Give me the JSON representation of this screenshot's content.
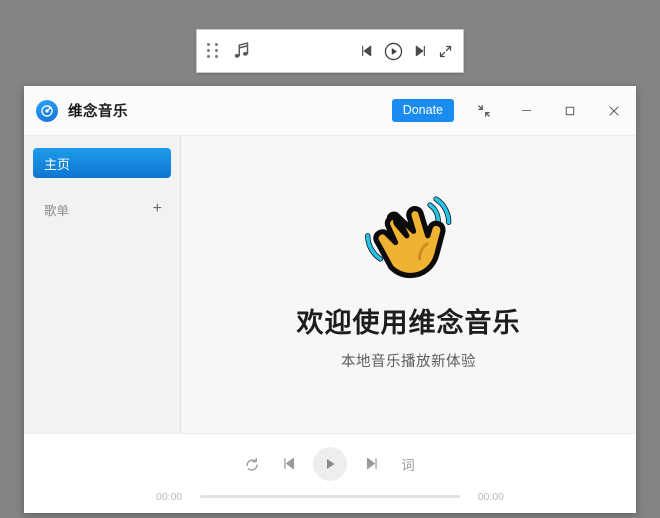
{
  "desktop": {
    "background_color": "#848484"
  },
  "mini_player": {
    "drag_handle_icon": "drag-dots-icon",
    "music_note_icon": "music-note-icon",
    "prev_icon": "skip-previous-icon",
    "play_icon": "play-circle-icon",
    "next_icon": "skip-next-icon",
    "expand_icon": "expand-icon"
  },
  "window": {
    "title": "维念音乐",
    "logo_icon": "app-logo-icon",
    "accent_color": "#1a8cf0",
    "actions": {
      "donate_label": "Donate",
      "shrink_icon": "shrink-to-mini-icon",
      "minimize_icon": "minimize-icon",
      "maximize_icon": "maximize-icon",
      "close_icon": "close-icon"
    }
  },
  "sidebar": {
    "home_label": "主页",
    "playlists_label": "歌单",
    "add_playlist_label": "+",
    "selected_color": "#0f75d2"
  },
  "content": {
    "emoji_icon": "waving-hand-icon",
    "title": "欢迎使用维念音乐",
    "subtitle": "本地音乐播放新体验"
  },
  "player": {
    "repeat_icon": "repeat-icon",
    "prev_icon": "skip-previous-icon",
    "play_icon": "play-icon",
    "next_icon": "skip-next-icon",
    "lyrics_label": "词",
    "elapsed_time": "00:00",
    "total_time": "00:00",
    "progress_percent": 0
  }
}
